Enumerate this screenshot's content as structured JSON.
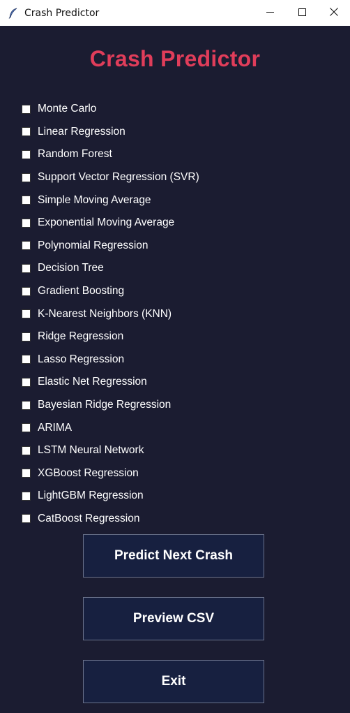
{
  "window": {
    "title": "Crash Predictor",
    "controls": [
      "minimize-icon",
      "maximize-icon",
      "close-icon"
    ]
  },
  "header": {
    "title": "Crash Predictor",
    "title_color": "#e03d5a"
  },
  "models": [
    {
      "label": "Monte Carlo",
      "checked": false
    },
    {
      "label": "Linear Regression",
      "checked": false
    },
    {
      "label": "Random Forest",
      "checked": false
    },
    {
      "label": "Support Vector Regression (SVR)",
      "checked": false
    },
    {
      "label": "Simple Moving Average",
      "checked": false
    },
    {
      "label": "Exponential Moving Average",
      "checked": false
    },
    {
      "label": "Polynomial Regression",
      "checked": false
    },
    {
      "label": "Decision Tree",
      "checked": false
    },
    {
      "label": "Gradient Boosting",
      "checked": false
    },
    {
      "label": "K-Nearest Neighbors (KNN)",
      "checked": false
    },
    {
      "label": "Ridge Regression",
      "checked": false
    },
    {
      "label": "Lasso Regression",
      "checked": false
    },
    {
      "label": "Elastic Net Regression",
      "checked": false
    },
    {
      "label": "Bayesian Ridge Regression",
      "checked": false
    },
    {
      "label": "ARIMA",
      "checked": false
    },
    {
      "label": "LSTM Neural Network",
      "checked": false
    },
    {
      "label": "XGBoost Regression",
      "checked": false
    },
    {
      "label": "LightGBM Regression",
      "checked": false
    },
    {
      "label": "CatBoost Regression",
      "checked": false
    }
  ],
  "actions": {
    "predict_label": "Predict Next Crash",
    "preview_label": "Preview CSV",
    "exit_label": "Exit"
  },
  "colors": {
    "background": "#1b1c31",
    "button_bg": "#172040",
    "button_border": "#6b738c",
    "text": "#ffffff"
  }
}
